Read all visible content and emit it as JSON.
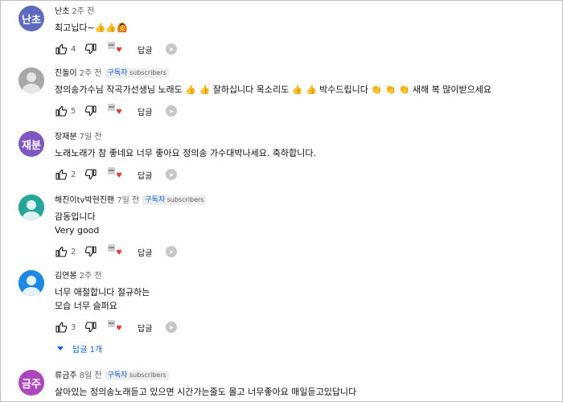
{
  "comments": [
    {
      "avatar_text": "난초",
      "avatar_color": "#5c6bc0",
      "author": "난초",
      "time": "2주 전",
      "subscriber": false,
      "lines": [
        "최고닙다~👍👍🙆"
      ],
      "likes": "4",
      "reply": "답글"
    },
    {
      "avatar_text": "",
      "avatar_color": "#9e9e9e",
      "author": "진돌이",
      "time": "2주 전",
      "subscriber": true,
      "subscriber_ko": "구독자",
      "subscriber_en": "subscribers",
      "lines": [
        "정의송가수님 작곡가선생님  노래도 👍 👍 잘하십니다  목소리도 👍 👍 박수드립니다 👏 👏 👏  새해 복 많이받으세요"
      ],
      "likes": "5",
      "reply": "답글"
    },
    {
      "avatar_text": "재분",
      "avatar_color": "#7e57c2",
      "author": "장재분",
      "time": "7일 전",
      "subscriber": false,
      "lines": [
        "노래노래가 참 좋네요 너무 좋아요 정의송  가수대박나세요. 축하합니다."
      ],
      "likes": "2",
      "reply": "답글"
    },
    {
      "avatar_text": "",
      "avatar_color": "#26a69a",
      "author": "해진이tv박현진팬",
      "time": "7일 전",
      "subscriber": true,
      "subscriber_ko": "구독자",
      "subscriber_en": "subscribers",
      "lines": [
        "감동입니다",
        "Very good"
      ],
      "likes": "2",
      "reply": "답글"
    },
    {
      "avatar_text": "",
      "avatar_color": "#1e88e5",
      "author": "김연봉",
      "time": "2주 전",
      "subscriber": false,
      "lines": [
        "너무 애절합니다 절규하는",
        "모습 너무 슬퍼요"
      ],
      "likes": "3",
      "reply": "답글"
    },
    {
      "avatar_text": "금주",
      "avatar_color": "#ab47bc",
      "author": "류금주",
      "time": "8일 전",
      "subscriber": true,
      "subscriber_ko": "구독자",
      "subscriber_en": "subscribers",
      "lines": [
        "살아있는 정의송노래듣고 있으면 시간가는줄도 몰고 너무좋아요   매일듣고있답니다"
      ]
    }
  ],
  "replies_toggle": "답글 1개",
  "icons": {
    "like": "thumbs-up-icon",
    "dislike": "thumbs-down-icon",
    "heart": "creator-heart-icon",
    "share": "share-icon"
  }
}
